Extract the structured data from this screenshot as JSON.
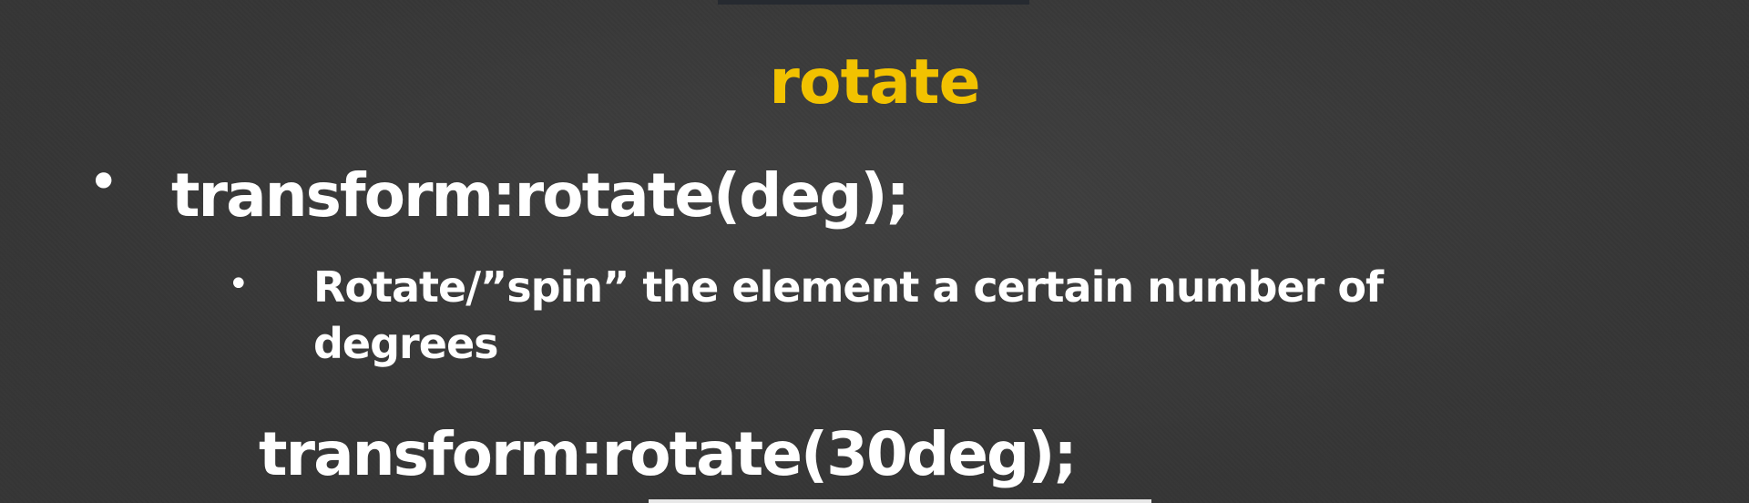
{
  "slide": {
    "title": "rotate",
    "title_color": "#f2c200",
    "text_color": "#ffffff",
    "bullet_glyph": "•",
    "main_bullet": "transform:rotate(deg);",
    "sub_bullet": "Rotate/”spin” the element a certain number of degrees",
    "example_code": "transform:rotate(30deg);"
  }
}
